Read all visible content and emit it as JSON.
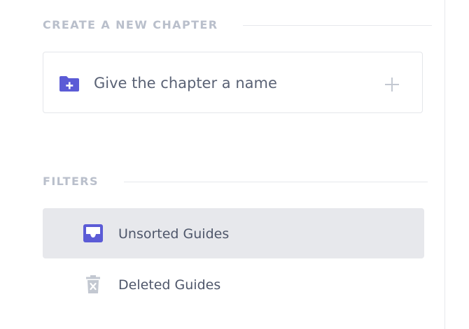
{
  "create_section": {
    "title": "CREATE A NEW CHAPTER",
    "input_placeholder": "Give the chapter a name",
    "input_value": "",
    "folder_icon": "folder-plus-icon",
    "add_icon": "plus-icon"
  },
  "filters_section": {
    "title": "FILTERS",
    "items": [
      {
        "label": "Unsorted Guides",
        "icon": "inbox-icon",
        "active": true
      },
      {
        "label": "Deleted Guides",
        "icon": "trash-icon",
        "active": false
      }
    ]
  },
  "colors": {
    "accent": "#5b5bd6",
    "muted_icon": "#c3c8d1",
    "active_row_bg": "#e7e8ec",
    "text": "#4e566a",
    "section_title": "#b9bfcb"
  }
}
